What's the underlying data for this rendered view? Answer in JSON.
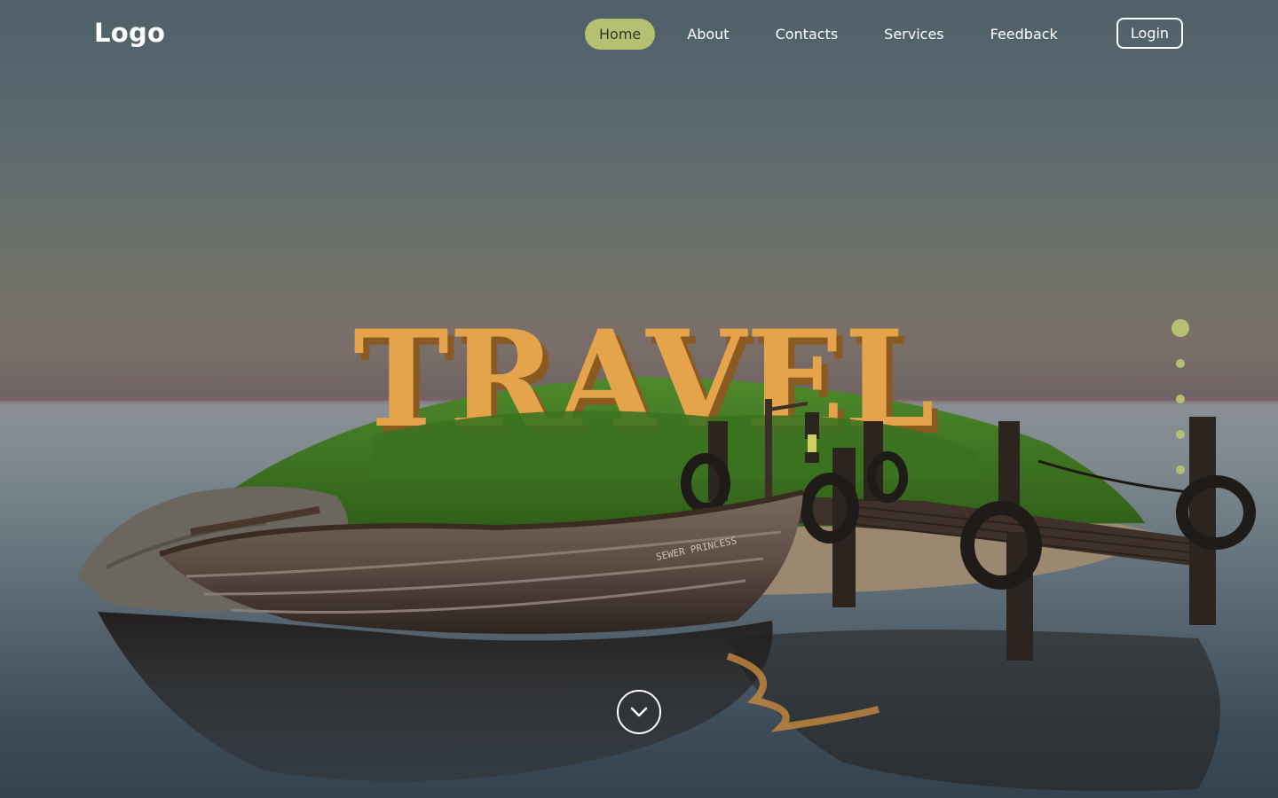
{
  "header": {
    "logo": "Logo",
    "nav": [
      {
        "label": "Home",
        "active": true
      },
      {
        "label": "About",
        "active": false
      },
      {
        "label": "Contacts",
        "active": false
      },
      {
        "label": "Services",
        "active": false
      },
      {
        "label": "Feedback",
        "active": false
      }
    ],
    "login_label": "Login"
  },
  "hero": {
    "title": "TRAVEL",
    "boat_name": "SEWER PRINCESS"
  },
  "pagination": {
    "count": 5,
    "active_index": 0
  },
  "icons": {
    "scroll": "chevron-down-icon"
  },
  "colors": {
    "accent": "#b5c171",
    "title": "#e5a44b",
    "grass": "#3f7a22"
  }
}
